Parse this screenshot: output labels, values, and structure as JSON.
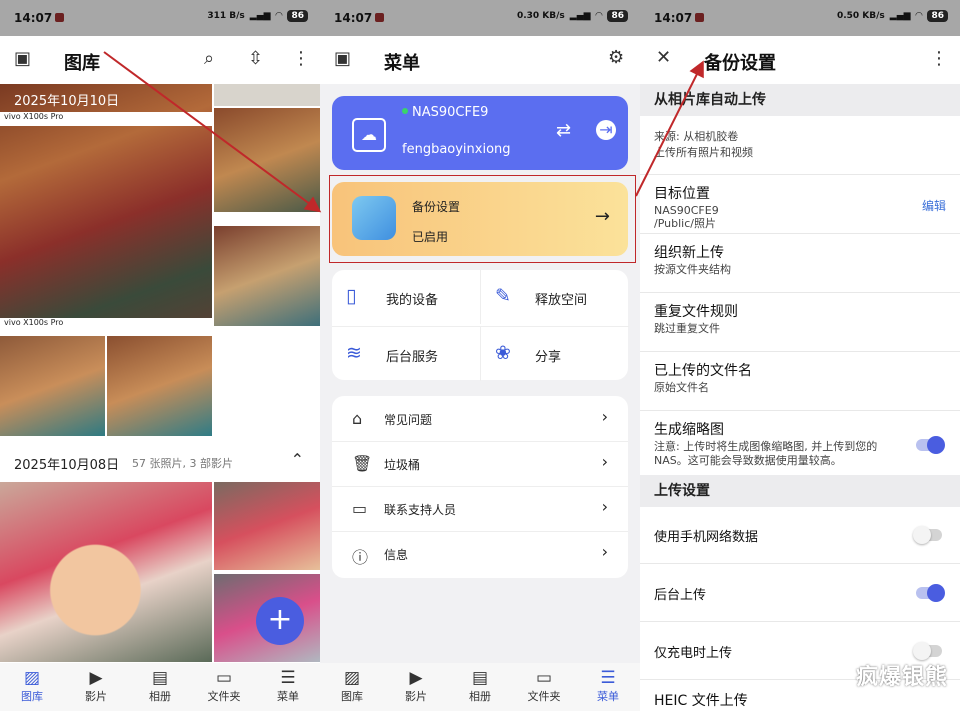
{
  "status": {
    "time": "14:07",
    "battery": "86",
    "net1": "311 B/s",
    "net2": "0.30 KB/s",
    "net3": "0.50 KB/s"
  },
  "gallery": {
    "title": "图库",
    "date1": "2025年10月10日",
    "date2": "2025年10月08日",
    "date2_meta": "57 张照片, 3 部影片",
    "photo_brand": "vivo X100s Pro"
  },
  "nav": {
    "items": [
      "图库",
      "影片",
      "相册",
      "文件夹",
      "菜单"
    ]
  },
  "menu": {
    "title": "菜单",
    "nas_name": "NAS90CFE9",
    "nas_user": "fengbaoyinxiong",
    "backup_title": "备份设置",
    "backup_status": "已启用",
    "grid": [
      "我的设备",
      "释放空间",
      "后台服务",
      "分享"
    ],
    "list": [
      "常见问题",
      "垃圾桶",
      "联系支持人员",
      "信息"
    ]
  },
  "settings": {
    "title": "备份设置",
    "sec1": "从相片库自动上传",
    "source_title": "来源: 从相机胶卷",
    "source_sub": "上传所有照片和视频",
    "target_title": "目标位置",
    "target_sub1": "NAS90CFE9",
    "target_sub2": "/Public/照片",
    "edit": "编辑",
    "organize_title": "组织新上传",
    "organize_sub": "按源文件夹结构",
    "dup_title": "重复文件规则",
    "dup_sub": "跳过重复文件",
    "name_title": "已上传的文件名",
    "name_sub": "原始文件名",
    "thumb_title": "生成缩略图",
    "thumb_sub": "注意: 上传时将生成图像缩略图, 并上传到您的 NAS。这可能会导致数据使用量较高。",
    "sec2": "上传设置",
    "mobile": "使用手机网络数据",
    "background": "后台上传",
    "charging": "仅充电时上传",
    "heic": "HEIC 文件上传"
  },
  "watermark": "疯爆银熊",
  "toggles": {
    "thumb": true,
    "mobile": false,
    "background": true,
    "charging": false
  }
}
